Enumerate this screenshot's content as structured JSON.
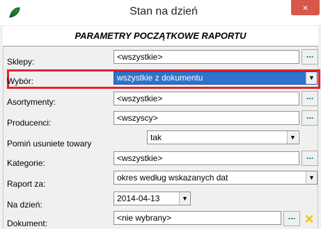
{
  "window": {
    "title": "Stan na dzień",
    "close_label": "×"
  },
  "section": {
    "header": "PARAMETRY POCZĄTKOWE RAPORTU"
  },
  "rows": {
    "sklepy": {
      "label": "Sklepy:",
      "value": "<wszystkie>",
      "button": "..."
    },
    "wybor": {
      "label": "Wybór:",
      "value": "wszystkie z dokumentu"
    },
    "asortymenty": {
      "label": "Asortymenty:",
      "value": "<wszystkie>",
      "button": "..."
    },
    "producenci": {
      "label": "Producenci:",
      "value": "<wszyscy>",
      "button": "..."
    },
    "pomin": {
      "label": "Pomiń usuniete towary",
      "value": "tak"
    },
    "kategorie": {
      "label": "Kategorie:",
      "value": "<wszystkie>",
      "button": "..."
    },
    "raport_za": {
      "label": "Raport za:",
      "value": "okres według wskazanych dat"
    },
    "na_dzien": {
      "label": "Na dzień:",
      "value": "2014-04-13"
    },
    "dokument": {
      "label": "Dokument:",
      "value": "<nie wybrany>",
      "button": "..."
    }
  },
  "colors": {
    "highlight": "#e0232e",
    "selection": "#2f74cc",
    "close": "#d9564a"
  },
  "icons": {
    "app": "green-leaf-icon",
    "dropdown": "chevron-down-icon",
    "clear": "yellow-x-icon"
  }
}
